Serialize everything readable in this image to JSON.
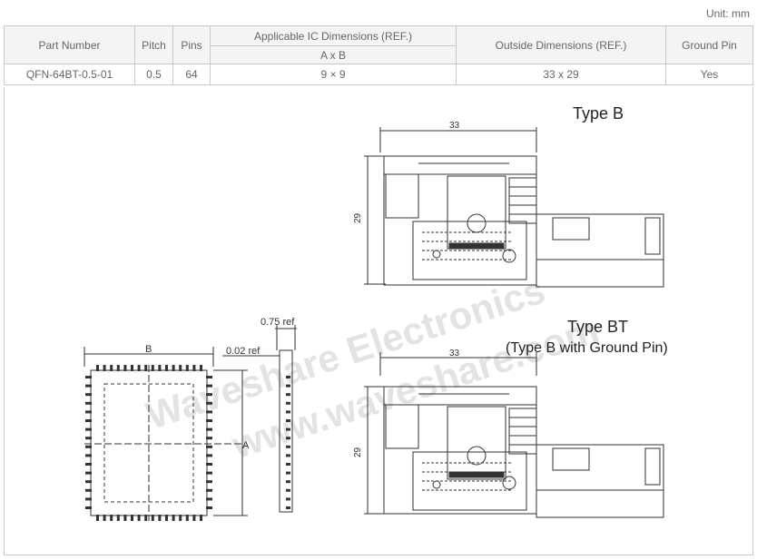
{
  "unit_label": "Unit: mm",
  "table": {
    "headers": {
      "part_number": "Part Number",
      "pitch": "Pitch",
      "pins": "Pins",
      "ic_dims": "Applicable IC Dimensions (REF.)",
      "ic_dims_sub": "A x B",
      "outside_dims": "Outside Dimensions (REF.)",
      "ground_pin": "Ground Pin"
    },
    "row": {
      "part_number": "QFN-64BT-0.5-01",
      "pitch": "0.5",
      "pins": "64",
      "ic_dims": "9 × 9",
      "outside_dims": "33 x 29",
      "ground_pin": "Yes"
    }
  },
  "drawing": {
    "type_b_title": "Type B",
    "type_bt_title": "Type BT",
    "type_bt_subtitle": "(Type B with Ground Pin)",
    "dim_33_top": "33",
    "dim_29_top": "29",
    "dim_33_bottom": "33",
    "dim_29_bottom": "29",
    "dim_b": "B",
    "dim_a": "A",
    "dim_075": "0.75 ref",
    "dim_002": "0.02 ref",
    "watermark_1": "Waveshare Electronics",
    "watermark_2": "www.waveshare.com"
  }
}
